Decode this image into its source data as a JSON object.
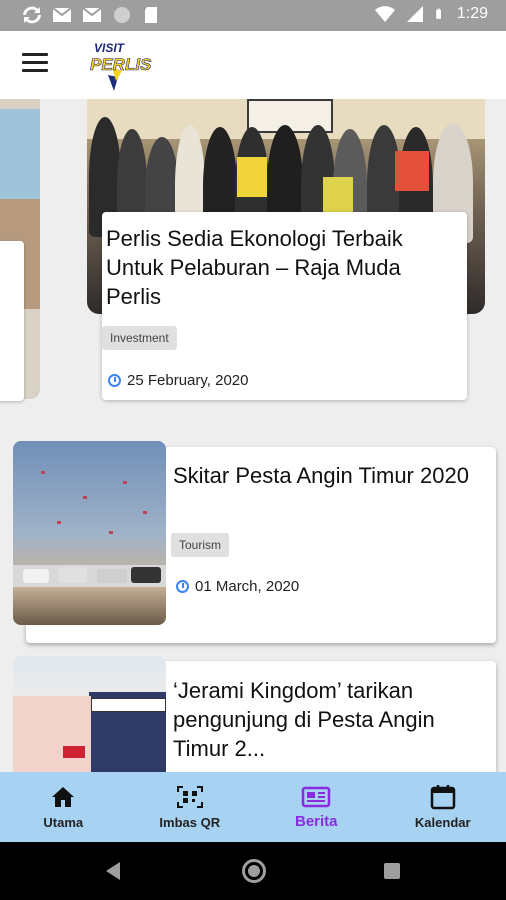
{
  "status_bar": {
    "time": "1:29"
  },
  "app": {
    "logo_line1": "VISIT",
    "logo_line2": "PERLIS"
  },
  "featured": {
    "title": "Perlis Sedia Ekonologi Terbaik Untuk Pelaburan – Raja Muda Perlis",
    "tag": "Investment",
    "date": "25 February, 2020"
  },
  "news": [
    {
      "title": "Skitar Pesta Angin Timur 2020",
      "tag": "Tourism",
      "date": "01 March, 2020"
    },
    {
      "title": "‘Jerami Kingdom’ tarikan pengunjung di Pesta Angin Timur 2..."
    }
  ],
  "bottom_nav": {
    "items": [
      {
        "label": "Utama",
        "icon": "home-icon"
      },
      {
        "label": "Imbas QR",
        "icon": "qr-code-icon"
      },
      {
        "label": "Berita",
        "icon": "newspaper-icon"
      },
      {
        "label": "Kalendar",
        "icon": "calendar-icon"
      }
    ],
    "active_index": 2
  },
  "colors": {
    "nav_bg": "#a8d2f2",
    "nav_active": "#8a2be2",
    "clock_icon": "#3b82f6"
  }
}
